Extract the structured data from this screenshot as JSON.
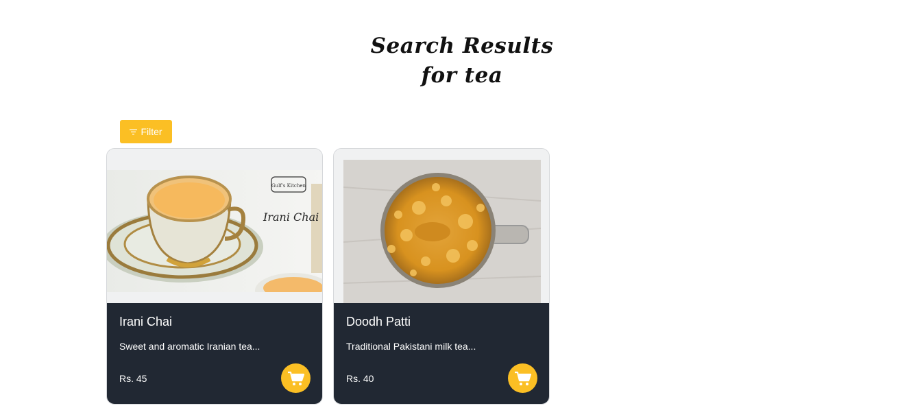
{
  "header": {
    "title": "Search Results for tea"
  },
  "filter": {
    "label": "Filter",
    "icon": "filter-icon"
  },
  "products": [
    {
      "name": "Irani Chai",
      "description": "Sweet and aromatic Iranian tea...",
      "price": "Rs. 45",
      "image_text": "Irani Chai",
      "image_logo": "Gulf's Kitchen",
      "cart_icon": "cart-icon"
    },
    {
      "name": "Doodh Patti",
      "description": "Traditional Pakistani milk tea...",
      "price": "Rs. 40",
      "cart_icon": "cart-icon"
    }
  ],
  "colors": {
    "accent": "#fbbf24",
    "card_body": "#212833",
    "card_border": "#d6d8db",
    "page_background": "#ffffff"
  }
}
